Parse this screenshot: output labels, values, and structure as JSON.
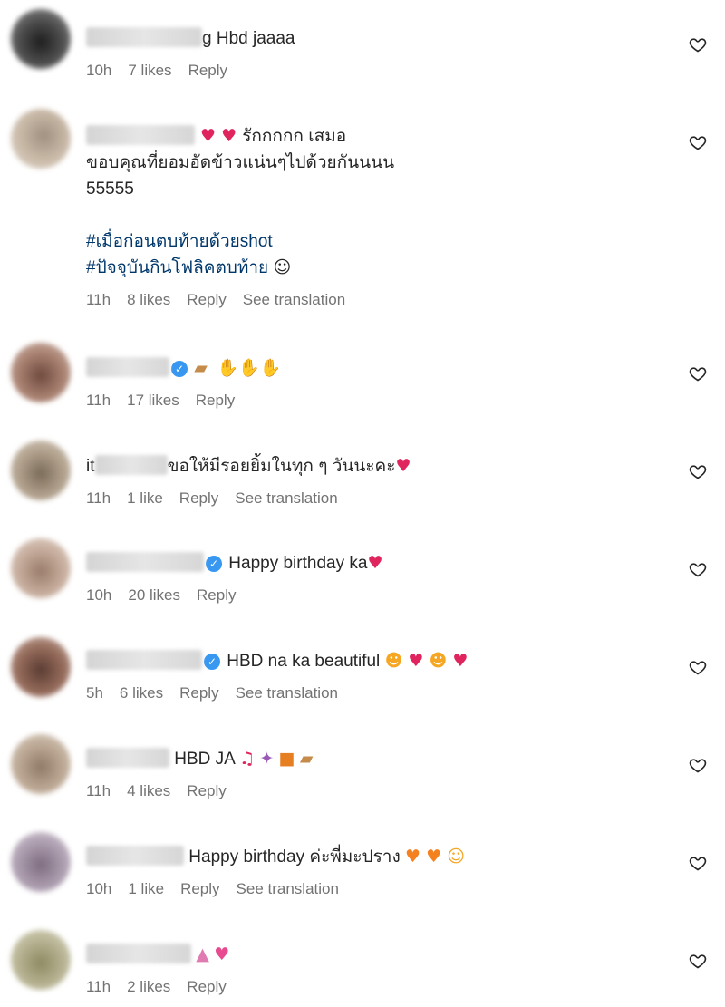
{
  "comments": [
    {
      "text": "g Hbd jaaaa",
      "time": "10h",
      "likes": "7 likes",
      "reply": "Reply"
    },
    {
      "text1": "รักกกกก เสมอ",
      "text2": "ขอบคุณที่ยอมอัดข้าวแน่นๆไปด้วยกันนนน",
      "text3": "55555",
      "hashtag1": "#เมื่อก่อนตบท้ายด้วยshot",
      "hashtag2": "#ปัจจุบันกินโฟลิคตบท้าย",
      "time": "11h",
      "likes": "8 likes",
      "reply": "Reply",
      "translation": "See translation"
    },
    {
      "time": "11h",
      "likes": "17 likes",
      "reply": "Reply"
    },
    {
      "user_prefix": "it",
      "text": "ขอให้มีรอยยิ้มในทุก ๆ วันนะคะ",
      "time": "11h",
      "likes": "1 like",
      "reply": "Reply",
      "translation": "See translation"
    },
    {
      "text": "Happy birthday ka",
      "time": "10h",
      "likes": "20 likes",
      "reply": "Reply"
    },
    {
      "text": "HBD na ka beautiful",
      "time": "5h",
      "likes": "6 likes",
      "reply": "Reply",
      "translation": "See translation"
    },
    {
      "text": "HBD JA",
      "time": "11h",
      "likes": "4 likes",
      "reply": "Reply"
    },
    {
      "text": "Happy birthday ค่ะพี่มะปราง",
      "time": "10h",
      "likes": "1 like",
      "reply": "Reply",
      "translation": "See translation"
    },
    {
      "time": "11h",
      "likes": "2 likes",
      "reply": "Reply"
    }
  ],
  "icons": {
    "like": "heart-outline-icon",
    "verified": "verified-badge-icon"
  },
  "colors": {
    "text": "#262626",
    "meta": "#737373",
    "hashtag": "#00376b",
    "verified": "#3897f0"
  }
}
